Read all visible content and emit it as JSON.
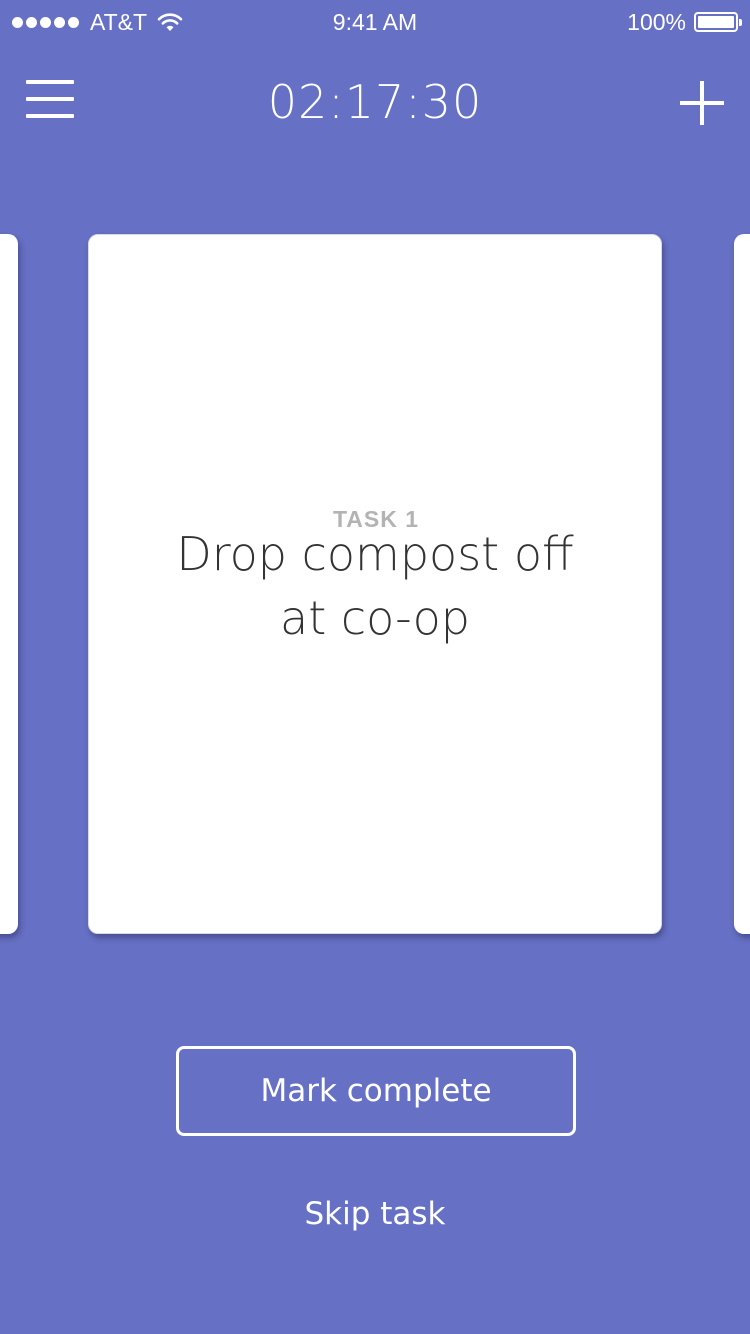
{
  "status_bar": {
    "carrier": "AT&T",
    "signal_strength": 5,
    "time": "9:41 AM",
    "battery_percent_text": "100%",
    "battery_level": 1.0,
    "signal_icon": "signal-dots-icon",
    "wifi_icon": "wifi-icon",
    "battery_icon": "battery-icon"
  },
  "header": {
    "timer": "02:17:30",
    "menu_icon": "hamburger-menu-icon",
    "add_icon": "plus-icon"
  },
  "task_card": {
    "label": "TASK 1",
    "title": "Drop compost off\nat co-op"
  },
  "actions": {
    "mark_complete_label": "Mark complete",
    "skip_task_label": "Skip task"
  },
  "colors": {
    "background": "#6670c4",
    "card": "#ffffff",
    "task_label": "#b3b3b3",
    "task_title": "#333333",
    "foreground": "#ffffff"
  }
}
